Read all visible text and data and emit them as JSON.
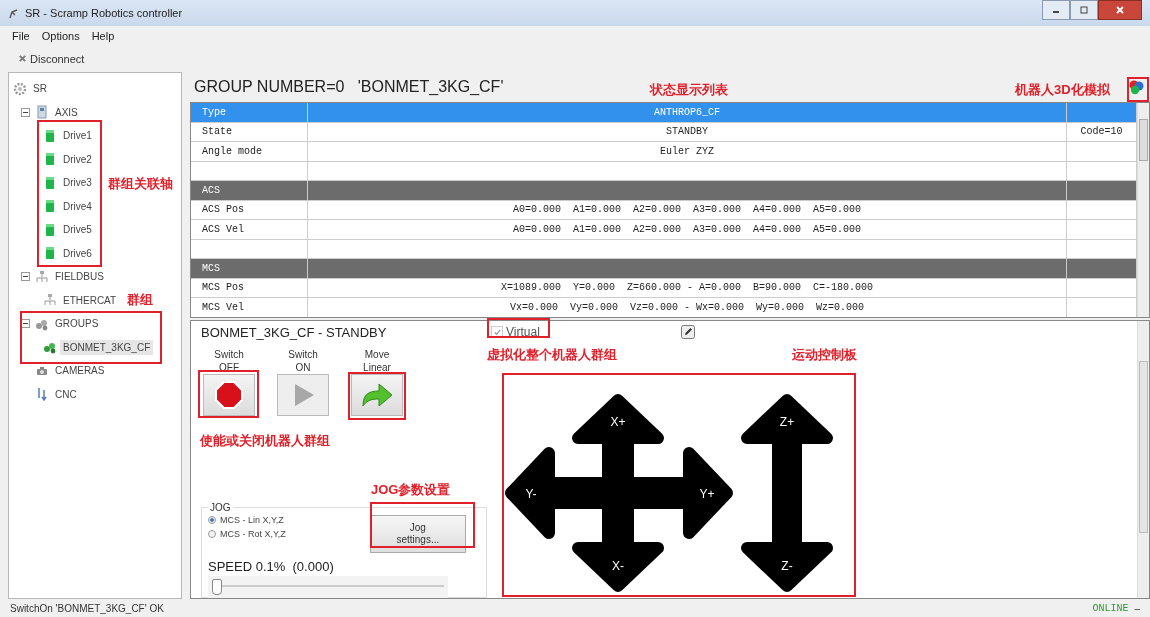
{
  "window": {
    "title": "SR - Scramp Robotics controller"
  },
  "menu": [
    "File",
    "Options",
    "Help"
  ],
  "toolbar": [
    {
      "label": "Disconnect"
    }
  ],
  "tree": [
    {
      "label": "SR",
      "kind": "gear",
      "selected": false,
      "children": [
        {
          "label": "AXIS",
          "kind": "device",
          "selected": false,
          "expanded": true,
          "children": [
            {
              "label": "Drive1",
              "kind": "drive",
              "selected": false
            },
            {
              "label": "Drive2",
              "kind": "drive",
              "selected": false
            },
            {
              "label": "Drive3",
              "kind": "drive",
              "selected": false
            },
            {
              "label": "Drive4",
              "kind": "drive",
              "selected": false
            },
            {
              "label": "Drive5",
              "kind": "drive",
              "selected": false
            },
            {
              "label": "Drive6",
              "kind": "drive",
              "selected": false
            }
          ]
        },
        {
          "label": "FIELDBUS",
          "kind": "network",
          "selected": false,
          "expanded": true,
          "children": [
            {
              "label": "ETHERCAT",
              "kind": "network",
              "selected": false
            }
          ]
        },
        {
          "label": "GROUPS",
          "kind": "robot-group",
          "selected": false,
          "expanded": true,
          "children": [
            {
              "label": "BONMET_3KG_CF",
              "kind": "robot",
              "selected": true
            }
          ]
        },
        {
          "label": "CAMERAS",
          "kind": "camera",
          "selected": false
        },
        {
          "label": "CNC",
          "kind": "cnc",
          "selected": false
        }
      ]
    }
  ],
  "group_header": {
    "title": "GROUP NUMBER=0   'BONMET_3KG_CF'"
  },
  "status_table": [
    {
      "kind": "row",
      "selected": true,
      "label": "Type",
      "value": "ANTHROP6_CF"
    },
    {
      "kind": "row",
      "selected": false,
      "label": "State",
      "value": "STANDBY",
      "code": "Code=10"
    },
    {
      "kind": "row",
      "selected": false,
      "label": "Angle mode",
      "value": "Euler ZYZ"
    },
    {
      "kind": "blank",
      "selected": false
    },
    {
      "kind": "section",
      "selected": false,
      "label": "ACS"
    },
    {
      "kind": "row",
      "selected": false,
      "label": "ACS Pos",
      "value": "A0=0.000  A1=0.000  A2=0.000  A3=0.000  A4=0.000  A5=0.000"
    },
    {
      "kind": "row",
      "selected": false,
      "label": "ACS Vel",
      "value": "A0=0.000  A1=0.000  A2=0.000  A3=0.000  A4=0.000  A5=0.000"
    },
    {
      "kind": "blank",
      "selected": false
    },
    {
      "kind": "section",
      "selected": false,
      "label": "MCS"
    },
    {
      "kind": "row",
      "selected": false,
      "label": "MCS Pos",
      "value": "X=1089.000  Y=0.000  Z=660.000 - A=0.000  B=90.000  C=-180.000"
    },
    {
      "kind": "row",
      "selected": false,
      "label": "MCS Vel",
      "value": "Vx=0.000  Vy=0.000  Vz=0.000 - Wx=0.000  Wy=0.000  Wz=0.000"
    }
  ],
  "control_panel": {
    "title": "BONMET_3KG_CF - STANDBY",
    "virtual": {
      "label": "Virtual",
      "checked": true
    },
    "actions": [
      {
        "label": "Switch OFF",
        "kind": "stop",
        "disabled": false
      },
      {
        "label": "Switch ON",
        "kind": "play",
        "disabled": true
      },
      {
        "label": "Move Linear",
        "kind": "move",
        "disabled": false
      }
    ],
    "jog": {
      "title": "JOG",
      "modes": [
        {
          "label": "MCS - Lin X,Y,Z",
          "selected": true
        },
        {
          "label": "MCS - Rot X,Y,Z",
          "selected": false
        }
      ],
      "settings_button": "Jog settings...",
      "speed_label": "SPEED 0.1%  (0.000)",
      "speed": {
        "level": 0
      }
    },
    "pad": [
      {
        "label": "X+",
        "kind": "up"
      },
      {
        "label": "Y-",
        "kind": "left"
      },
      {
        "label": "Y+",
        "kind": "right"
      },
      {
        "label": "X-",
        "kind": "down"
      },
      {
        "label": "Z+",
        "kind": "z-up"
      },
      {
        "label": "Z-",
        "kind": "z-down"
      }
    ]
  },
  "status_bar": {
    "message": "SwitchOn 'BONMET_3KG_CF' OK",
    "connection": "ONLINE",
    "indicator": "–"
  },
  "annotations": [
    "群组关联轴",
    "群组",
    "状态显示列表",
    "机器人3D化模拟",
    "使能或关闭机器人群组",
    "JOG参数设置",
    "虚拟化整个机器人群组",
    "运动控制板"
  ]
}
